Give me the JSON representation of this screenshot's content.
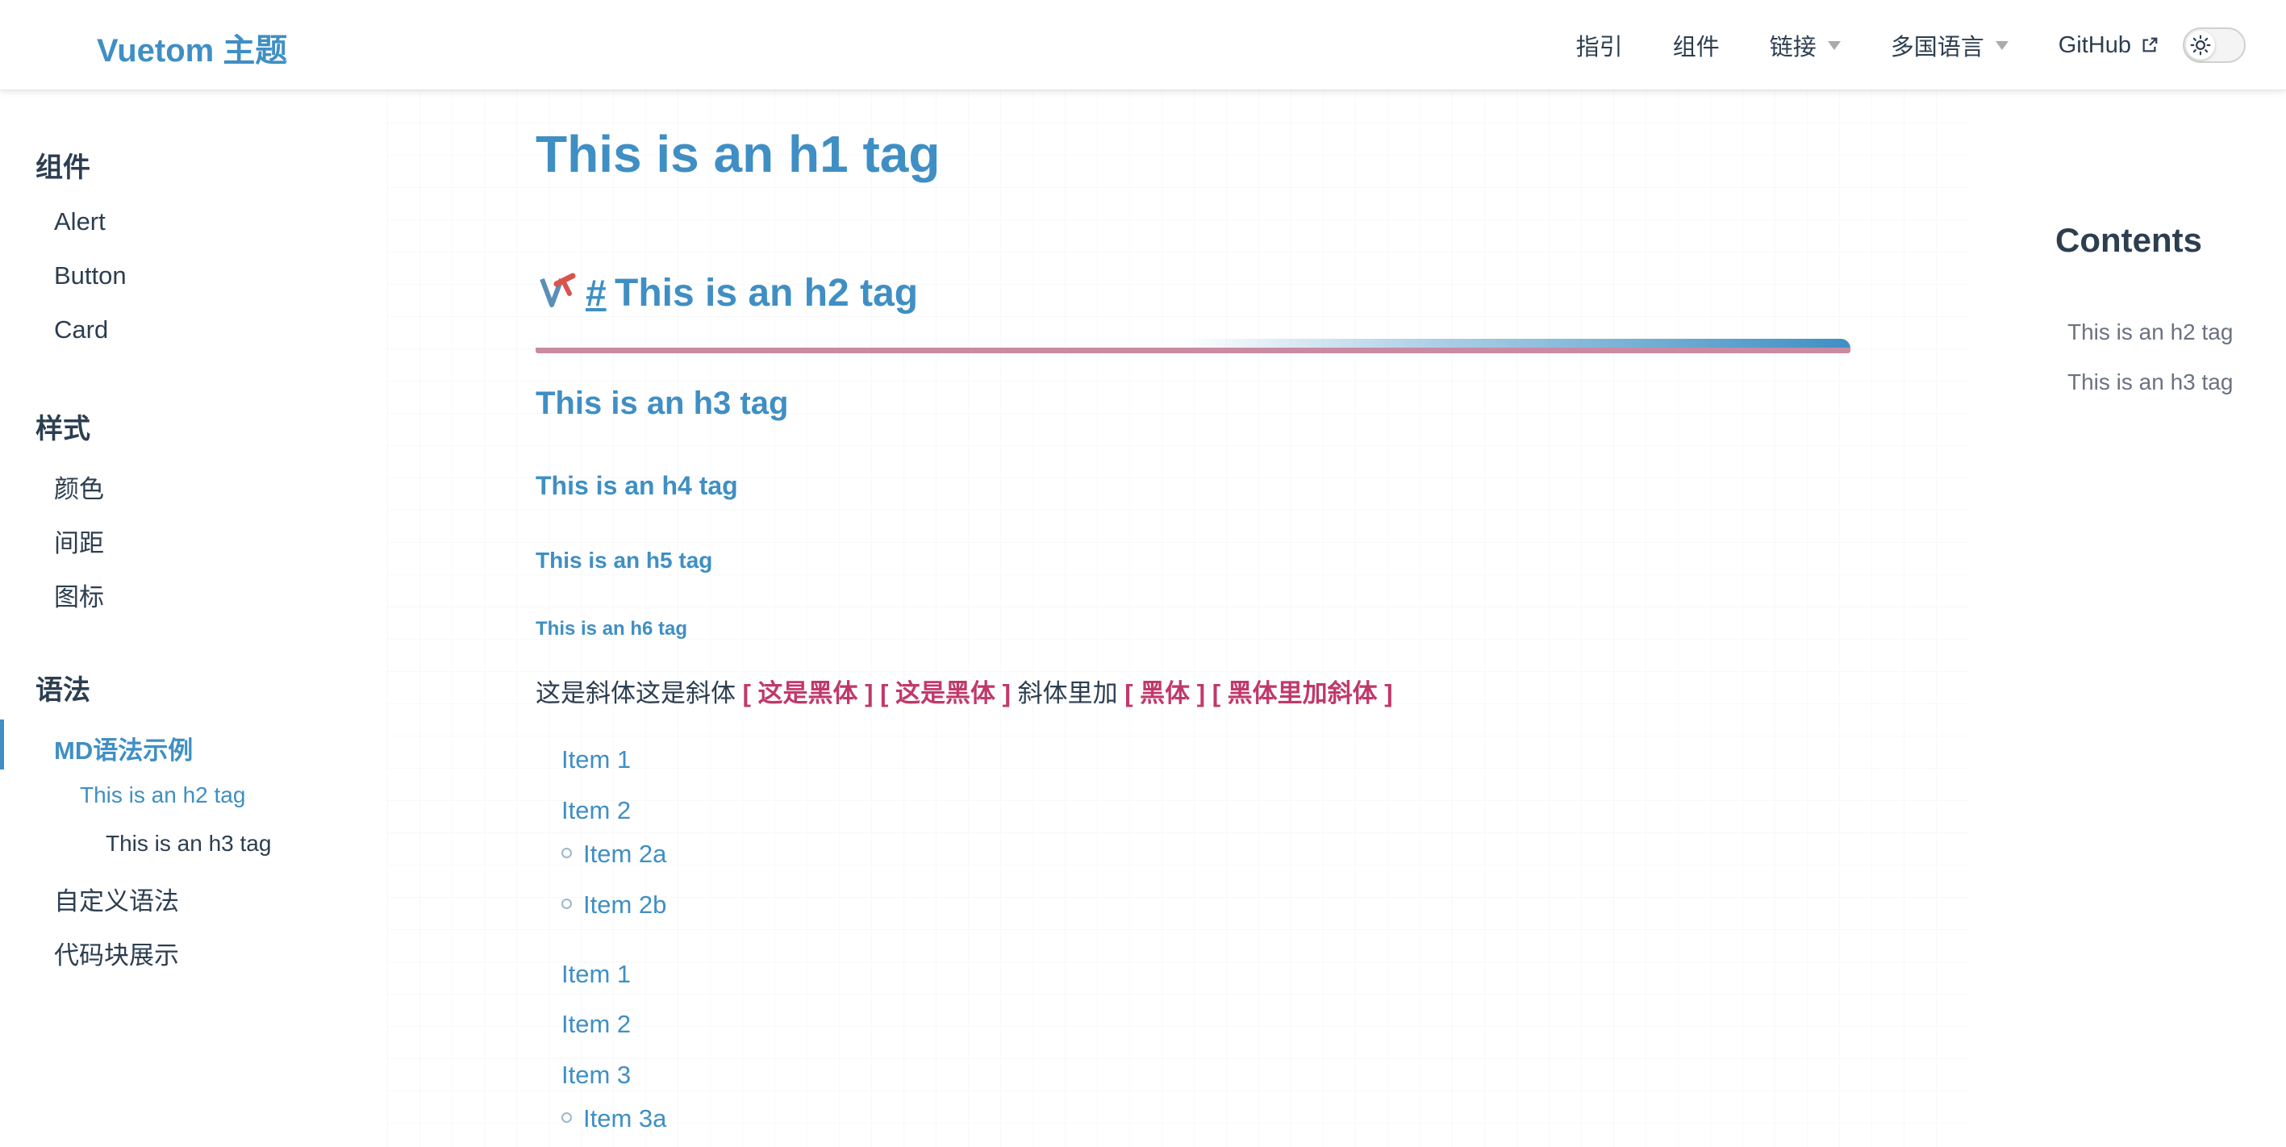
{
  "navbar": {
    "brand": "Vuetom 主题",
    "links": [
      {
        "label": "指引"
      },
      {
        "label": "组件"
      },
      {
        "label": "链接"
      },
      {
        "label": "多国语言"
      },
      {
        "label": "GitHub"
      }
    ]
  },
  "sidebar": {
    "groups": [
      {
        "title": "组件",
        "items": [
          "Alert",
          "Button",
          "Card"
        ]
      },
      {
        "title": "样式",
        "items": [
          "颜色",
          "间距",
          "图标"
        ]
      },
      {
        "title": "语法",
        "items": [
          "MD语法示例",
          "自定义语法",
          "代码块展示"
        ]
      }
    ],
    "active_item": "MD语法示例",
    "sub_items": [
      "This is an h2 tag",
      "This is an h3 tag"
    ]
  },
  "main": {
    "h1": "This is an h1 tag",
    "h2_hash": "#",
    "h2": "This is an h2 tag",
    "h3": "This is an h3 tag",
    "h4": "This is an h4 tag",
    "h5": "This is an h5 tag",
    "h6": "This is an h6 tag",
    "paragraph": {
      "italic_text": "这是斜体这是斜体",
      "bold1": "[ 这是黑体 ]",
      "bold2": "[ 这是黑体 ]",
      "middle_text": "斜体里加",
      "bold3": "[ 黑体 ]",
      "bold4": "[ 黑体里加斜体 ]"
    },
    "list1": [
      "Item 1",
      "Item 2"
    ],
    "list1_sub": [
      "Item 2a",
      "Item 2b"
    ],
    "list2": [
      "Item 1",
      "Item 2",
      "Item 3"
    ],
    "list2_sub": [
      "Item 3a"
    ]
  },
  "toc": {
    "title": "Contents",
    "links": [
      "This is an h2 tag",
      "This is an h3 tag"
    ]
  },
  "colors": {
    "accent": "#3f8fc4",
    "emphasis": "#c0396b",
    "text": "#2c3e50"
  }
}
